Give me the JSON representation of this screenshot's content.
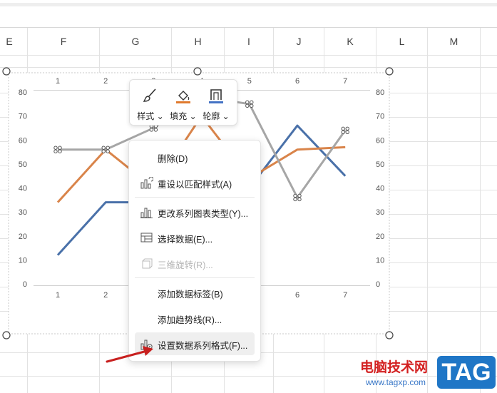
{
  "column_headers": [
    "E",
    "F",
    "G",
    "H",
    "I",
    "J",
    "K",
    "L",
    "M"
  ],
  "chart": {
    "top_axis_labels": [
      "1",
      "2",
      "3",
      "4",
      "5",
      "6",
      "7"
    ],
    "bottom_axis_labels": [
      "1",
      "2",
      "3",
      "4",
      "5",
      "6",
      "7"
    ],
    "left_axis_labels": [
      "0",
      "10",
      "20",
      "30",
      "40",
      "50",
      "60",
      "70",
      "80"
    ],
    "right_axis_labels": [
      "0",
      "10",
      "20",
      "30",
      "40",
      "50",
      "60",
      "70",
      "80"
    ]
  },
  "chart_data": {
    "type": "line",
    "x": [
      1,
      2,
      3,
      4,
      5,
      6,
      7
    ],
    "series": [
      {
        "color": "#4a71a9",
        "values": [
          12,
          34,
          34,
          50,
          40,
          66,
          45
        ]
      },
      {
        "color": "#d9844a",
        "values": [
          34,
          56,
          40,
          70,
          44,
          56,
          57
        ]
      },
      {
        "color": "#a6a6a6",
        "values": [
          56,
          56,
          65,
          78,
          75,
          36,
          64
        ],
        "selected": true
      }
    ],
    "ylim": [
      0,
      80
    ],
    "grid": false,
    "secondary_axis": true
  },
  "toolbar": {
    "style_label": "样式",
    "fill_label": "填充",
    "outline_label": "轮廓",
    "fill_color": "#e07a2e",
    "outline_color": "#4472c4"
  },
  "context_menu": {
    "items": [
      {
        "label": "删除(D)",
        "icon": "none",
        "disabled": false
      },
      {
        "label": "重设以匹配样式(A)",
        "icon": "chart-reset-icon",
        "disabled": false
      },
      {
        "label": "更改系列图表类型(Y)...",
        "icon": "chart-type-icon",
        "disabled": false
      },
      {
        "label": "选择数据(E)...",
        "icon": "select-data-icon",
        "disabled": false
      },
      {
        "label": "三维旋转(R)...",
        "icon": "3d-rotate-icon",
        "disabled": true
      },
      {
        "label": "添加数据标签(B)",
        "icon": "none",
        "disabled": false
      },
      {
        "label": "添加趋势线(R)...",
        "icon": "none",
        "disabled": false
      },
      {
        "label": "设置数据系列格式(F)...",
        "icon": "format-series-icon",
        "disabled": false
      }
    ]
  },
  "watermark": {
    "site_name": "电脑技术网",
    "url": "www.tagxp.com",
    "logo_text": "TAG"
  }
}
